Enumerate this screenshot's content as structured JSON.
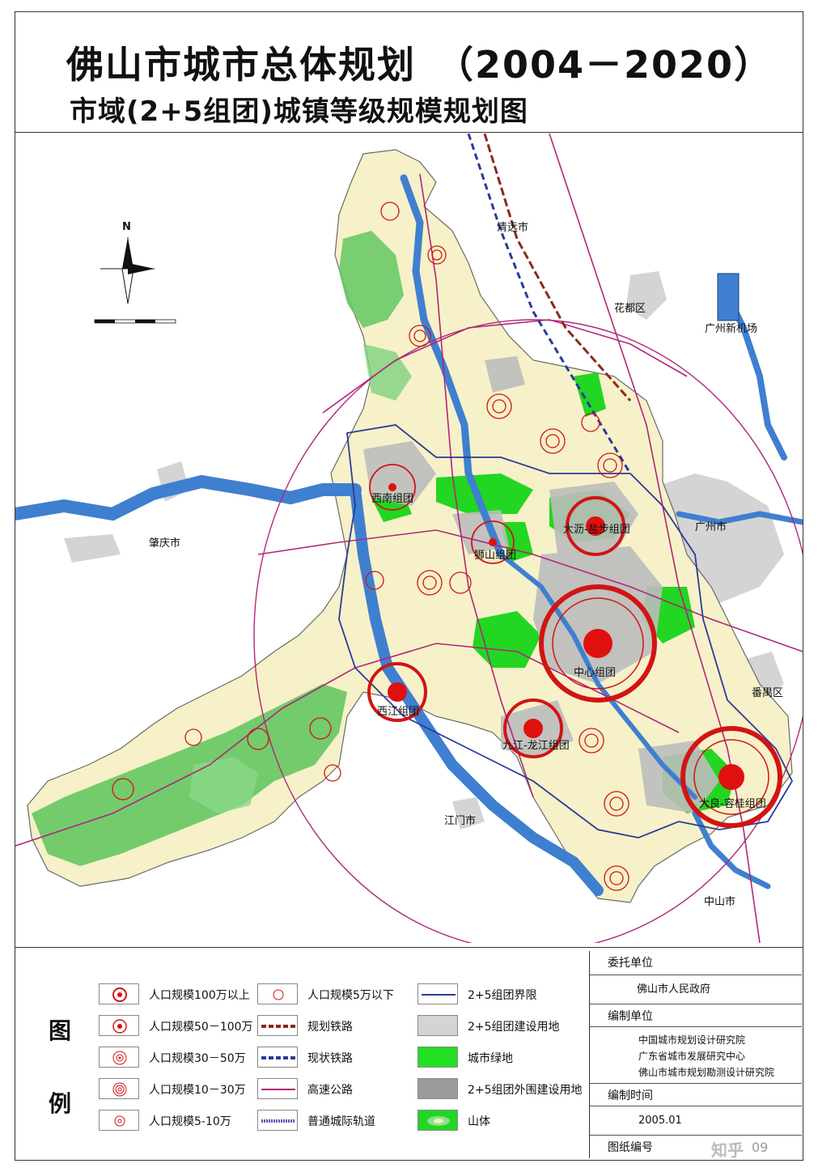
{
  "title": {
    "main": "佛山市城市总体规划　（2004－2020）",
    "sub": "市域(2+5组团)城镇等级规模规划图"
  },
  "map_labels": {
    "north": "N",
    "qingyuan": "清远市",
    "huadu": "花都区",
    "airport": "广州新机场",
    "zhaoqing": "肇庆市",
    "guangzhou": "广州市",
    "panyu": "番禺区",
    "jiangmen": "江门市",
    "zhongshan": "中山市",
    "xinan": "西南组团",
    "shishan": "狮山组团",
    "dali": "大沥-盐步组团",
    "center": "中心组团",
    "xijiang": "西江组团",
    "jiujiang": "九江-龙江组团",
    "ronggui": "大良-容桂组团"
  },
  "legend": {
    "heading_1": "图",
    "heading_2": "例",
    "items": [
      {
        "label": "人口规模100万以上",
        "icon": "city-100w-icon"
      },
      {
        "label": "人口规模50－100万",
        "icon": "city-50w-icon"
      },
      {
        "label": "人口规模30－50万",
        "icon": "city-30w-icon"
      },
      {
        "label": "人口规模10－30万",
        "icon": "city-10w-icon"
      },
      {
        "label": "人口规模5-10万",
        "icon": "city-5w-icon"
      },
      {
        "label": "人口规模5万以下",
        "icon": "town-icon"
      },
      {
        "label": "规划铁路",
        "icon": "planned-railway-icon"
      },
      {
        "label": "现状铁路",
        "icon": "existing-railway-icon"
      },
      {
        "label": "高速公路",
        "icon": "expressway-icon"
      },
      {
        "label": "普通城际轨道",
        "icon": "intercity-rail-icon"
      },
      {
        "label": "2+5组团界限",
        "icon": "cluster-boundary-icon"
      },
      {
        "label": "2+5组团建设用地",
        "icon": "cluster-land-icon"
      },
      {
        "label": "城市绿地",
        "icon": "green-space-icon"
      },
      {
        "label": "2+5组团外围建设用地",
        "icon": "outer-land-icon"
      },
      {
        "label": "山体",
        "icon": "mountain-icon"
      }
    ]
  },
  "info": {
    "client_label": "委托单位",
    "client": "佛山市人民政府",
    "maker_label": "编制单位",
    "maker_1": "中国城市规划设计研究院",
    "maker_2": "广东省城市发展研究中心",
    "maker_3": "佛山市城市规划勘测设计研究院",
    "date_label": "编制时间",
    "date": "2005.01",
    "sheet_label": "图纸编号",
    "sheet_no": "09",
    "watermark": "知乎"
  },
  "colors": {
    "river": "#3f7fd0",
    "land": "#f6f1c8",
    "green": "#22d622",
    "grey": "#c9c9c9",
    "darkgrey": "#9a9a9a",
    "expressway": "#b0267a",
    "ring": "#d21414",
    "boundary": "#2a3b9a"
  }
}
